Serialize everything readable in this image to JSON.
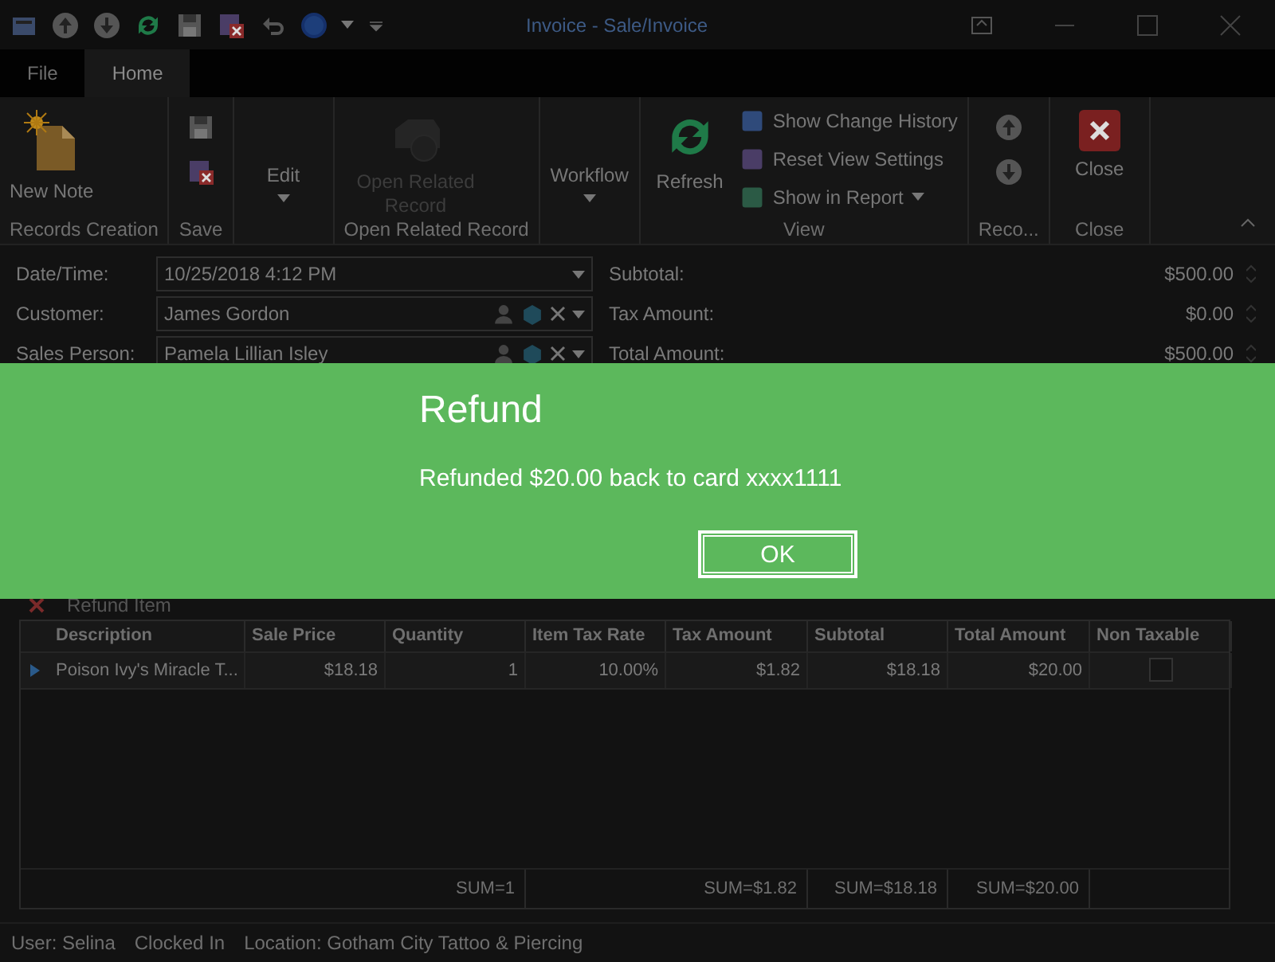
{
  "title_bar": {
    "title": "Invoice  - Sale/Invoice"
  },
  "tabs": [
    {
      "label": "File",
      "selected": false
    },
    {
      "label": "Home",
      "selected": true
    }
  ],
  "ribbon": {
    "groups": [
      {
        "label": "Records Creation",
        "items": [
          {
            "kind": "large",
            "label": "New Note",
            "disabled": false
          }
        ]
      },
      {
        "label": "Save",
        "items": [
          {
            "kind": "icon",
            "disabled": false
          },
          {
            "kind": "icon",
            "disabled": false
          }
        ]
      },
      {
        "items": [
          {
            "kind": "dropdown",
            "label": "Edit",
            "disabled": false
          }
        ]
      },
      {
        "label": "Open Related Record",
        "items": [
          {
            "kind": "large",
            "label": "Open Related Record",
            "disabled": true
          }
        ]
      },
      {
        "items": [
          {
            "kind": "dropdown",
            "label": "Workflow",
            "disabled": false
          }
        ]
      },
      {
        "label": "View",
        "items": [
          {
            "kind": "large",
            "label": "Refresh",
            "disabled": false
          },
          {
            "kind": "small",
            "label": "Show Change History",
            "disabled": false
          },
          {
            "kind": "small",
            "label": "Reset View Settings",
            "disabled": false
          },
          {
            "kind": "small-dropdown",
            "label": "Show in Report",
            "disabled": false
          }
        ]
      },
      {
        "label": "Reco...",
        "items": [
          {
            "kind": "icon",
            "disabled": false
          },
          {
            "kind": "icon",
            "disabled": false
          }
        ]
      },
      {
        "label": "Close",
        "items": [
          {
            "kind": "large",
            "label": "Close",
            "disabled": false
          }
        ]
      }
    ]
  },
  "form": {
    "fields": [
      {
        "label": "Date/Time:",
        "value": "10/25/2018 4:12 PM",
        "kind": "date"
      },
      {
        "label": "Customer:",
        "value": "James Gordon",
        "kind": "lookup"
      },
      {
        "label": "Sales Person:",
        "value": "Pamela Lillian Isley",
        "kind": "lookup"
      }
    ],
    "totals": [
      {
        "label": "Subtotal:",
        "value": "$500.00"
      },
      {
        "label": "Tax Amount:",
        "value": "$0.00"
      },
      {
        "label": "Total Amount:",
        "value": "$500.00"
      }
    ]
  },
  "grid": {
    "toolbar": {
      "refund_button": "Refund Item"
    },
    "columns": [
      {
        "label": "Description"
      },
      {
        "label": "Sale Price"
      },
      {
        "label": "Quantity"
      },
      {
        "label": "Item Tax Rate"
      },
      {
        "label": "Tax Amount"
      },
      {
        "label": "Subtotal"
      },
      {
        "label": "Total Amount"
      },
      {
        "label": "Non Taxable"
      }
    ],
    "rows": [
      {
        "cells": [
          "Poison Ivy's Miracle T...",
          "$18.18",
          "1",
          "10.00%",
          "$1.82",
          "$18.18",
          "$20.00"
        ],
        "non_taxable": false,
        "selected": true
      }
    ],
    "summary_row": {
      "quantity": "SUM=1",
      "tax_amount": "SUM=$1.82",
      "subtotal": "SUM=$18.18",
      "total_amount": "SUM=$20.00"
    }
  },
  "status_bar": [
    "User: Selina",
    "Clocked In",
    "Location: Gotham City Tattoo & Piercing"
  ],
  "dialog": {
    "title": "Refund",
    "message": "Refunded $20.00 back to card xxxx1111",
    "button": "OK"
  }
}
